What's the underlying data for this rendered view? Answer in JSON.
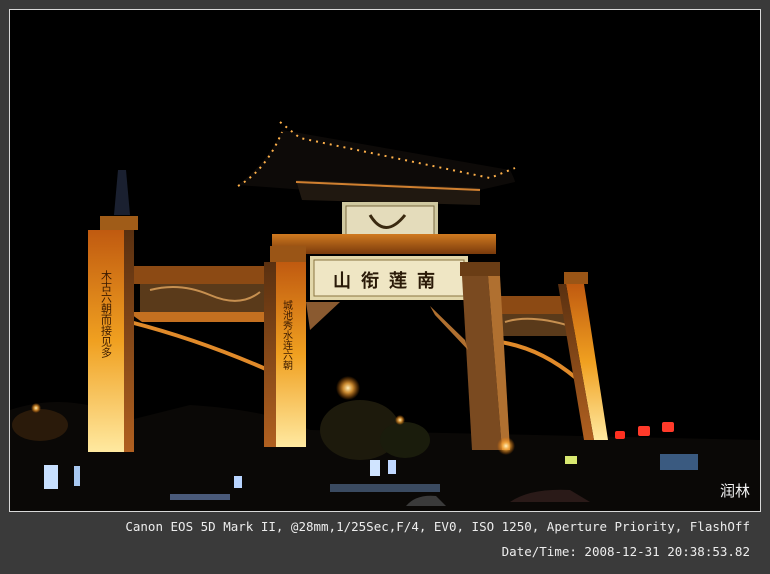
{
  "photo": {
    "signature": "润林",
    "gate": {
      "top_plaque": "",
      "main_plaque": "山衔莲南",
      "left_pillar_text": "木古六朝而接见多",
      "center_pillar_text": "城池秀水连六朝"
    }
  },
  "exif": {
    "camera_line": "Canon EOS 5D Mark II,  @28mm,1/25Sec,F/4, EV0, ISO 1250, Aperture Priority, FlashOff",
    "datetime_line": "Date/Time: 2008-12-31 20:38:53.82"
  },
  "colors": {
    "background": "#3a3a3a",
    "frame_border": "#d8d8d8",
    "exif_text": "#ededed",
    "pillar_glow": "#f0a020",
    "plaque": "#e8dcb0"
  }
}
